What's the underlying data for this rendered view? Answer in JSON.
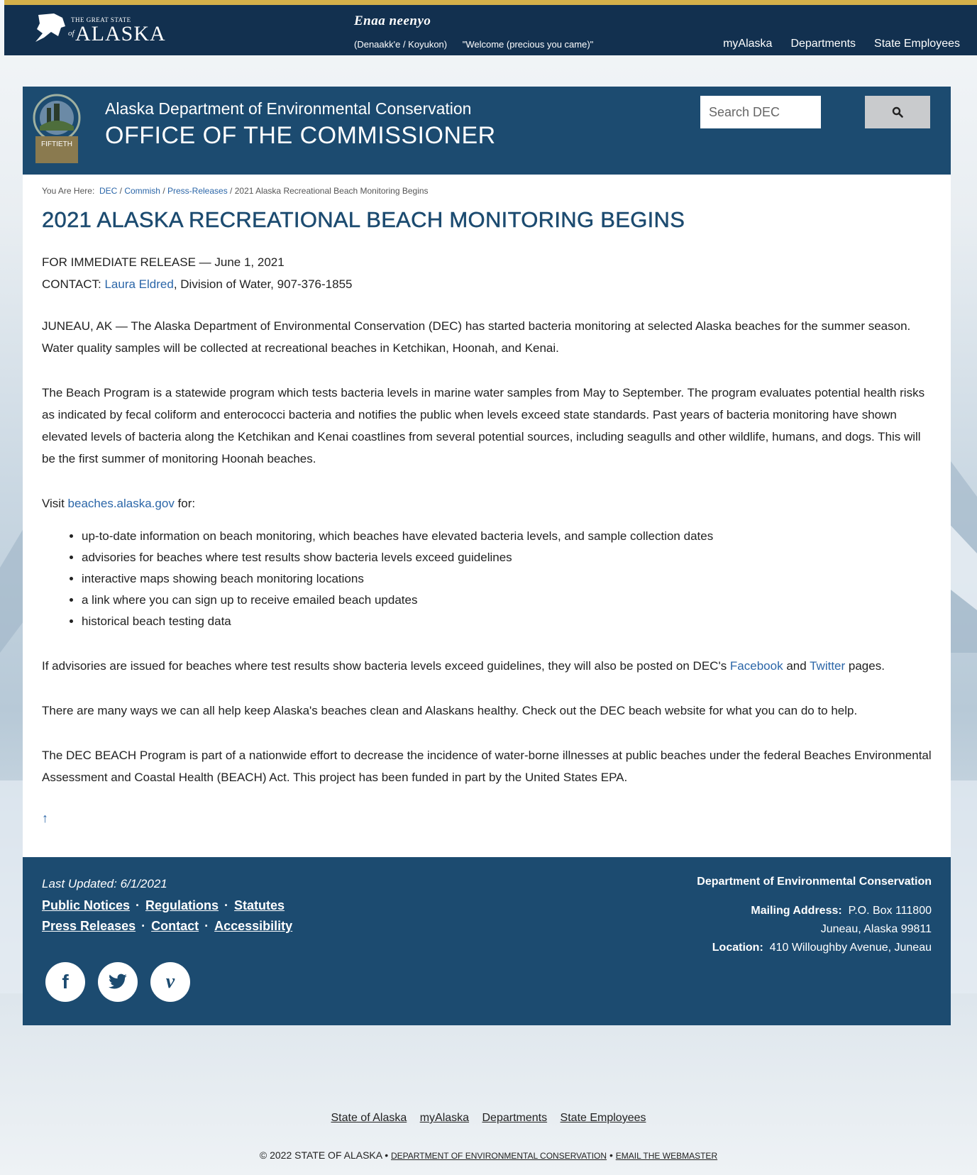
{
  "topbar": {
    "logo_great": "THE GREAT STATE",
    "logo_of": "of",
    "logo_alaska": "ALASKA",
    "greeting": "Enaa neenyo",
    "greeting_language": "(Denaakk'e / Koyukon)",
    "greeting_translation": "\"Welcome (precious you came)\"",
    "nav": [
      "myAlaska",
      "Departments",
      "State Employees"
    ]
  },
  "header": {
    "department": "Alaska Department of Environmental Conservation",
    "office": "OFFICE OF THE COMMISSIONER",
    "seal_text": "FIFTIETH",
    "search_placeholder": "Search DEC"
  },
  "breadcrumb": {
    "label": "You Are Here:",
    "links": [
      "DEC",
      "Commish",
      "Press-Releases"
    ],
    "current": "2021 Alaska Recreational Beach Monitoring Begins"
  },
  "article": {
    "title": "2021 ALASKA RECREATIONAL BEACH MONITORING BEGINS",
    "release": "FOR IMMEDIATE RELEASE  — June 1, 2021",
    "contact_label": "CONTACT: ",
    "contact_name": "Laura Eldred",
    "contact_rest": ", Division of Water, 907-376-1855",
    "p1": "JUNEAU, AK — The Alaska Department of Environmental Conservation (DEC) has started bacteria monitoring at selected Alaska beaches for the summer season. Water quality samples will be collected at recreational beaches in Ketchikan, Hoonah, and Kenai.",
    "p2": "The Beach Program is a statewide program which tests bacteria levels in marine water samples from May to September. The program evaluates potential health risks as indicated by fecal coliform and enterococci bacteria and notifies the public when levels exceed state standards. Past years of bacteria monitoring have shown elevated levels of bacteria along the Ketchikan and Kenai coastlines from several potential sources, including seagulls and other wildlife, humans, and dogs. This will be the first summer of monitoring Hoonah beaches.",
    "visit_pre": "Visit ",
    "visit_link": "beaches.alaska.gov",
    "visit_post": " for:",
    "bullets": [
      "up-to-date information on beach monitoring, which beaches have elevated bacteria levels, and sample collection dates",
      "advisories for beaches where test results show bacteria levels exceed guidelines",
      "interactive maps showing beach monitoring locations",
      "a link where you can sign up to receive emailed beach updates",
      "historical beach testing data"
    ],
    "p3_pre": "If advisories are issued for beaches where test results show bacteria levels exceed guidelines, they will also be posted on DEC's ",
    "p3_facebook": "Facebook",
    "p3_and": " and ",
    "p3_twitter": "Twitter",
    "p3_post": " pages.",
    "p4": "There are many ways we can all help keep Alaska's beaches clean and Alaskans healthy. Check out the DEC beach website for what you can do to help.",
    "p5": "The DEC BEACH Program is part of a nationwide effort to decrease the incidence of water-borne illnesses at public beaches under the federal Beaches Environmental Assessment and Coastal Health (BEACH) Act. This project has been funded in part by the United States EPA.",
    "back_to_top": "↑"
  },
  "footer": {
    "last_updated": "Last Updated: 6/1/2021",
    "links_row1": [
      "Public Notices",
      "Regulations",
      "Statutes"
    ],
    "links_row2": [
      "Press Releases",
      "Contact",
      "Accessibility"
    ],
    "separator": "·",
    "dept_name": "Department of Environmental Conservation",
    "mailing_label": "Mailing Address:",
    "mailing_line1": "P.O. Box 111800",
    "mailing_line2": "Juneau, Alaska 99811",
    "location_label": "Location:",
    "location_value": "410 Willoughby Avenue, Juneau",
    "socials": [
      "f",
      "t",
      "v"
    ]
  },
  "bottom": {
    "links": [
      "State of Alaska",
      "myAlaska",
      "Departments",
      "State Employees"
    ],
    "copyright": "© 2022 STATE OF ALASKA • ",
    "dept_link": "DEPARTMENT OF ENVIRONMENTAL CONSERVATION",
    "bullet": " • ",
    "webmaster_link": "EMAIL THE WEBMASTER"
  },
  "colors": {
    "navy": "#12304f",
    "header_blue": "#1c4b70",
    "gold": "#d4b04a",
    "link": "#2b66a8"
  }
}
